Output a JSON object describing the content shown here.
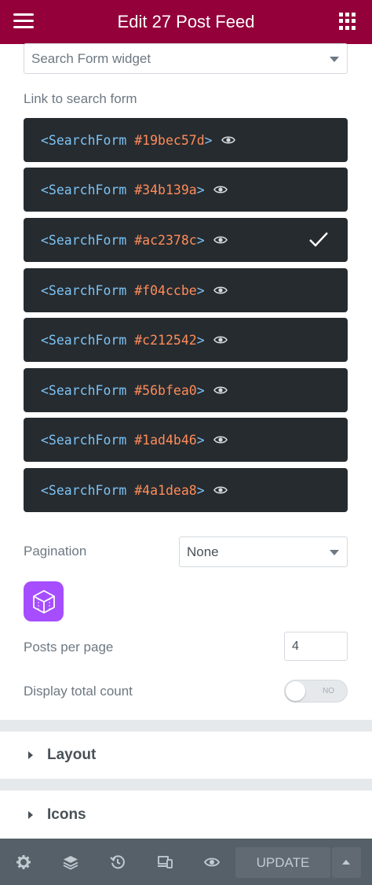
{
  "header": {
    "title": "Edit 27 Post Feed",
    "menu_icon": "hamburger-icon",
    "apps_icon": "grid-icon"
  },
  "source_select": {
    "value": "Search Form widget"
  },
  "link_label": "Link to search form",
  "search_forms": [
    {
      "open": "<SearchForm ",
      "id": "#19bec57d",
      "close": ">",
      "selected": false
    },
    {
      "open": "<SearchForm ",
      "id": "#34b139a",
      "close": ">",
      "selected": false
    },
    {
      "open": "<SearchForm ",
      "id": "#ac2378c",
      "close": ">",
      "selected": true
    },
    {
      "open": "<SearchForm ",
      "id": "#f04ccbe",
      "close": ">",
      "selected": false
    },
    {
      "open": "<SearchForm ",
      "id": "#c212542",
      "close": ">",
      "selected": false
    },
    {
      "open": "<SearchForm ",
      "id": "#56bfea0",
      "close": ">",
      "selected": false
    },
    {
      "open": "<SearchForm ",
      "id": "#1ad4b46",
      "close": ">",
      "selected": false
    },
    {
      "open": "<SearchForm ",
      "id": "#4a1dea8",
      "close": ">",
      "selected": false
    }
  ],
  "pagination": {
    "label": "Pagination",
    "value": "None"
  },
  "posts_per_page": {
    "label": "Posts per page",
    "value": "4"
  },
  "total_count": {
    "label": "Display total count",
    "toggle_text": "NO",
    "on": false
  },
  "sections": [
    {
      "title": "Layout"
    },
    {
      "title": "Icons"
    }
  ],
  "footer": {
    "update_label": "UPDATE",
    "icons": [
      "gear-icon",
      "layers-icon",
      "history-icon",
      "responsive-icon",
      "eye-icon"
    ]
  },
  "colors": {
    "header_bg": "#93003a",
    "item_bg": "#262b2f",
    "bracket": "#7dc3f6",
    "id": "#ff8c5a",
    "footer_bg": "#556068",
    "app_icon_bg": "#a64dff"
  }
}
